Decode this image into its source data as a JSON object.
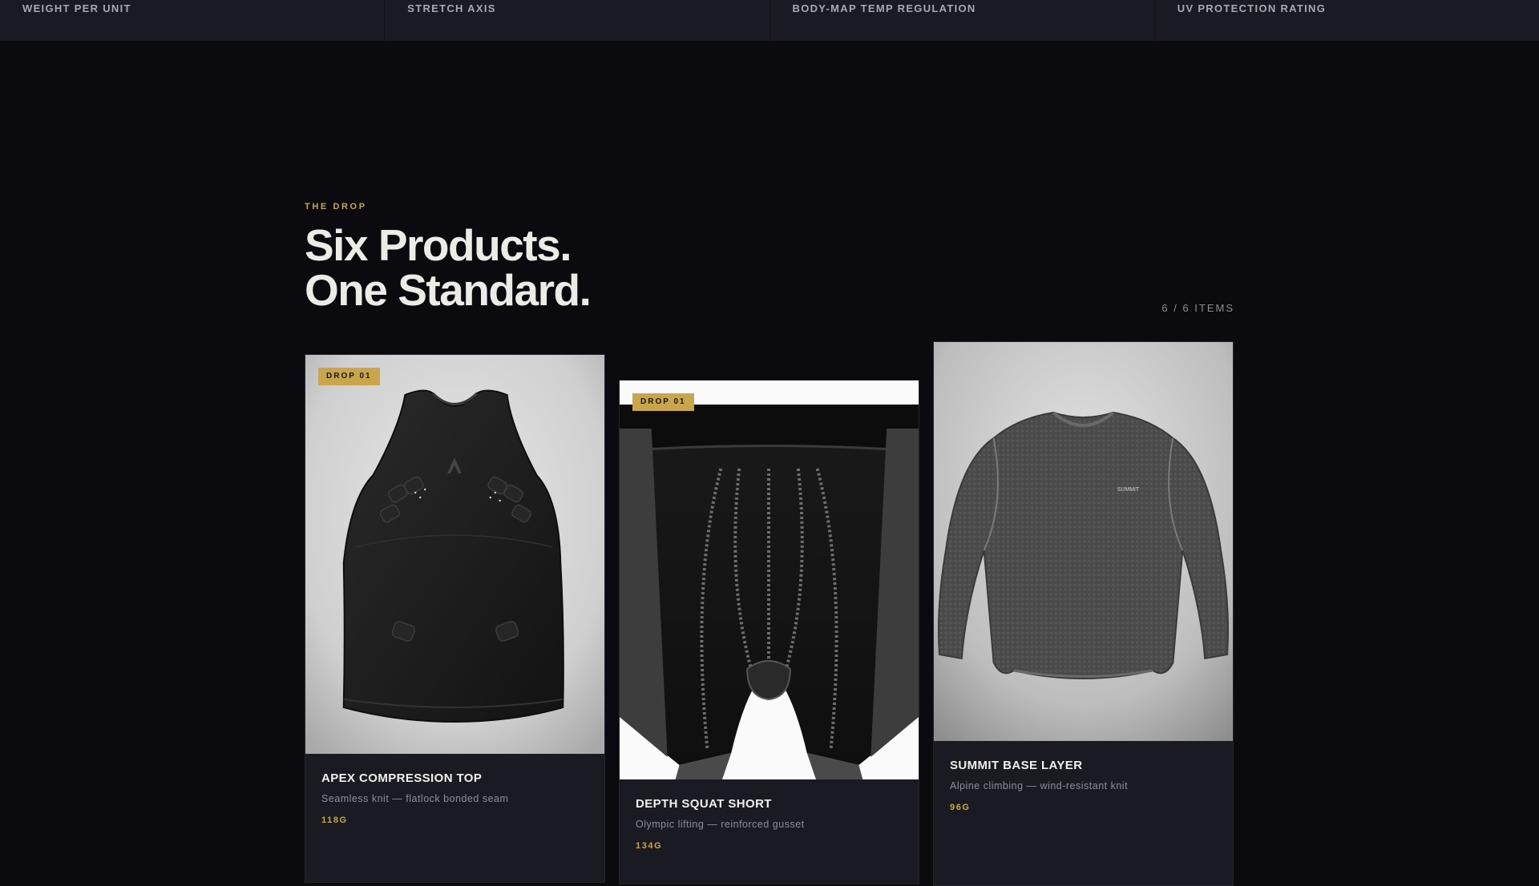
{
  "spec_strip": [
    {
      "label": "WEIGHT PER UNIT"
    },
    {
      "label": "STRETCH AXIS"
    },
    {
      "label": "BODY-MAP TEMP REGULATION"
    },
    {
      "label": "UV PROTECTION RATING"
    }
  ],
  "section": {
    "eyebrow": "THE DROP",
    "headline_line1": "Six Products.",
    "headline_line2": "One Standard.",
    "counter": "6 / 6 ITEMS"
  },
  "products": [
    {
      "badge": "DROP 01",
      "title": "APEX COMPRESSION TOP",
      "description": "Seamless knit — flatlock bonded seam",
      "weight": "118G",
      "image": "black-compression-tank-top"
    },
    {
      "badge": "DROP 01",
      "title": "DEPTH SQUAT SHORT",
      "description": "Olympic lifting — reinforced gusset",
      "weight": "134G",
      "image": "black-squat-short"
    },
    {
      "title": "SUMMIT BASE LAYER",
      "description": "Alpine climbing — wind-resistant knit",
      "weight": "96G",
      "image": "grey-long-sleeve-base-layer",
      "logo_text": "SUMMIT"
    }
  ],
  "colors": {
    "background": "#0b0b0f",
    "panel": "#1a1b22",
    "accent_gold": "#c9a64a",
    "headline": "#ecebe6"
  }
}
